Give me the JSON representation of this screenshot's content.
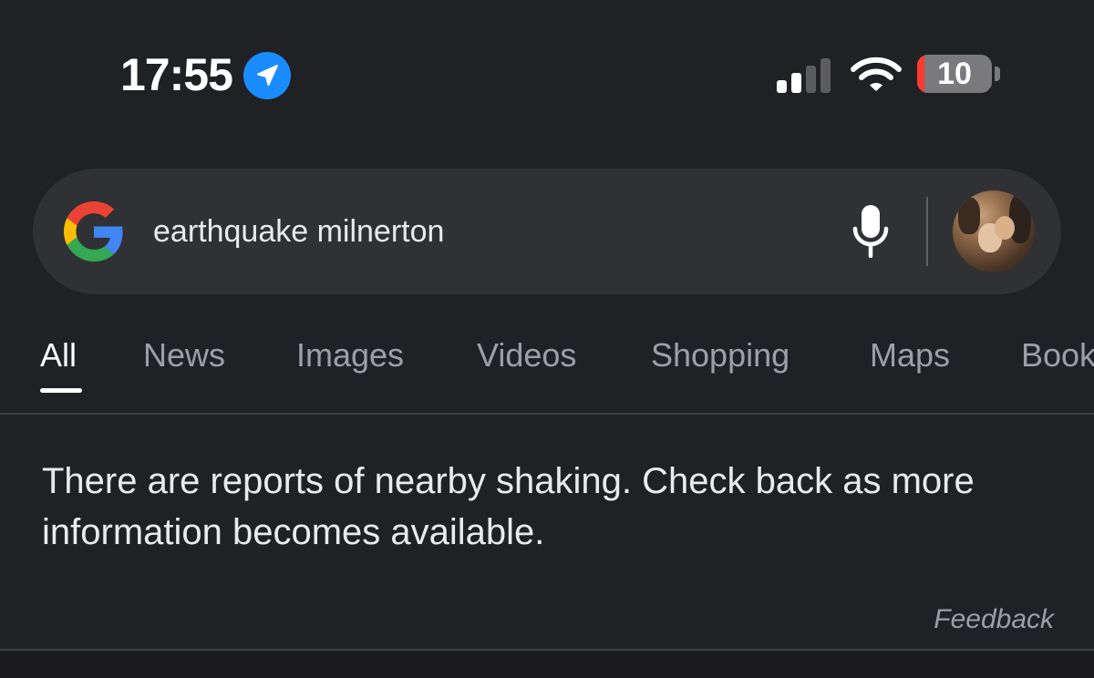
{
  "status_bar": {
    "time": "17:55",
    "battery_level": "10",
    "battery_percent": 10,
    "signal_bars_active": 2,
    "signal_bars_total": 4,
    "icons": [
      "location-arrow-icon",
      "cellular-signal-icon",
      "wifi-icon",
      "battery-icon"
    ]
  },
  "search": {
    "query": "earthquake milnerton",
    "icons": [
      "google-g-icon",
      "microphone-icon"
    ]
  },
  "tabs": [
    {
      "label": "All",
      "active": true
    },
    {
      "label": "News",
      "active": false
    },
    {
      "label": "Images",
      "active": false
    },
    {
      "label": "Videos",
      "active": false
    },
    {
      "label": "Shopping",
      "active": false
    },
    {
      "label": "Maps",
      "active": false
    },
    {
      "label": "Books",
      "active": false
    }
  ],
  "alert": {
    "text": "There are reports of nearby shaking. Check back as more information becomes available.",
    "feedback_label": "Feedback"
  },
  "colors": {
    "background": "#202124",
    "search_bar": "#303134",
    "accent_blue": "#1a8cff",
    "battery_low": "#ff3b30",
    "tab_inactive": "#9aa0a6",
    "text_primary": "#e8eaed"
  }
}
